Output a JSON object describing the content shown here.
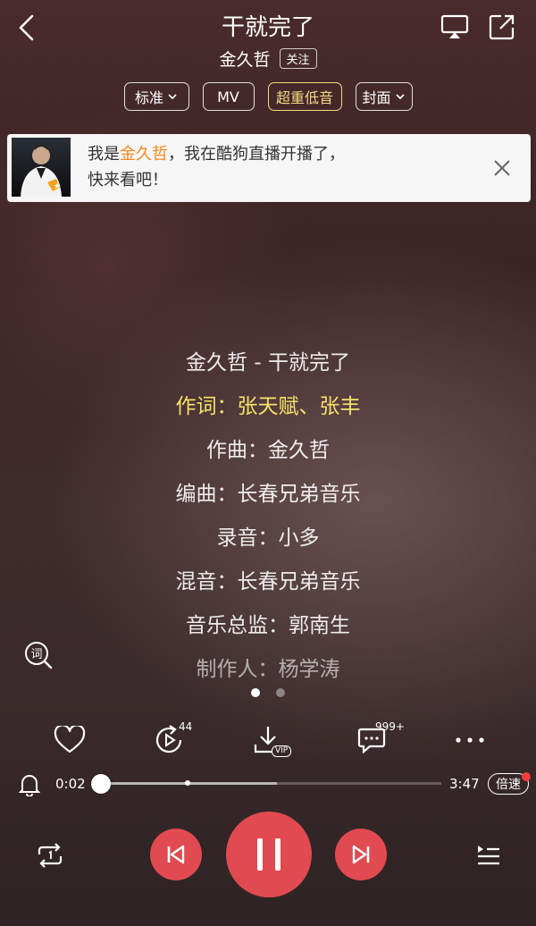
{
  "header": {
    "title": "干就完了",
    "artist": "金久哲",
    "follow_label": "关注"
  },
  "chips": [
    {
      "label": "标准",
      "has_arrow": true
    },
    {
      "label": "MV",
      "has_arrow": false
    },
    {
      "label": "超重低音",
      "has_arrow": false,
      "highlight": true
    },
    {
      "label": "封面",
      "has_arrow": true
    }
  ],
  "live_banner": {
    "line1_prefix": "我是",
    "line1_name": "金久哲",
    "line1_suffix": "，我在酷狗直播开播了，",
    "line2": "快来看吧！"
  },
  "lyrics": [
    {
      "text": "金久哲 - 干就完了",
      "state": "normal"
    },
    {
      "text": "作词：张天赋、张丰",
      "state": "active"
    },
    {
      "text": "作曲：金久哲",
      "state": "normal"
    },
    {
      "text": "编曲：长春兄弟音乐",
      "state": "normal"
    },
    {
      "text": "录音：小多",
      "state": "normal"
    },
    {
      "text": "混音：长春兄弟音乐",
      "state": "normal"
    },
    {
      "text": "音乐总监：郭南生",
      "state": "normal"
    },
    {
      "text": "制作人：杨学涛",
      "state": "dim"
    }
  ],
  "pager": {
    "count": 2,
    "active_index": 0
  },
  "actions": {
    "like_icon": "heart-icon",
    "related_count": "44",
    "download_badge": "VIP",
    "comment_count": "999+",
    "more_icon": "more-icon"
  },
  "progress": {
    "current": "0:02",
    "total": "3:47",
    "played_fraction": 0.009,
    "buffered_fraction": 0.52,
    "speed_label": "倍速"
  },
  "icons": {
    "lyric_toggle_char": "词"
  },
  "colors": {
    "accent": "#e04a50",
    "active_lyric": "#f6e26a",
    "live_highlight": "#f08a1f",
    "badge_red": "#ee3d3d"
  }
}
